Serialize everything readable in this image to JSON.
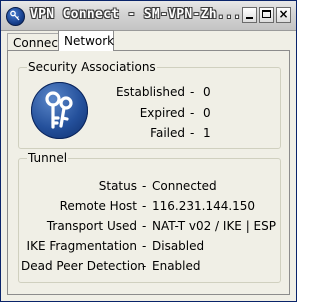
{
  "window": {
    "title": "VPN Connect - SM-VPN-Zh...",
    "controls": {
      "minimize": "minimize",
      "maximize": "maximize",
      "close": "×"
    }
  },
  "tabs": [
    {
      "label": "Connect",
      "active": false
    },
    {
      "label": "Network",
      "active": true
    }
  ],
  "security_associations": {
    "title": "Security Associations",
    "rows": [
      {
        "label": "Established",
        "value": "0"
      },
      {
        "label": "Expired",
        "value": "0"
      },
      {
        "label": "Failed",
        "value": "1"
      }
    ]
  },
  "tunnel": {
    "title": "Tunnel",
    "rows": [
      {
        "label": "Status",
        "value": "Connected"
      },
      {
        "label": "Remote Host",
        "value": "116.231.144.150"
      },
      {
        "label": "Transport Used",
        "value": "NAT-T v02 / IKE | ESP"
      },
      {
        "label": "IKE Fragmentation",
        "value": "Disabled"
      },
      {
        "label": "Dead Peer Detection",
        "value": "Enabled"
      }
    ]
  },
  "separator": "-",
  "colors": {
    "icon_blue": "#24509b",
    "window_bg": "#f0efe6"
  }
}
